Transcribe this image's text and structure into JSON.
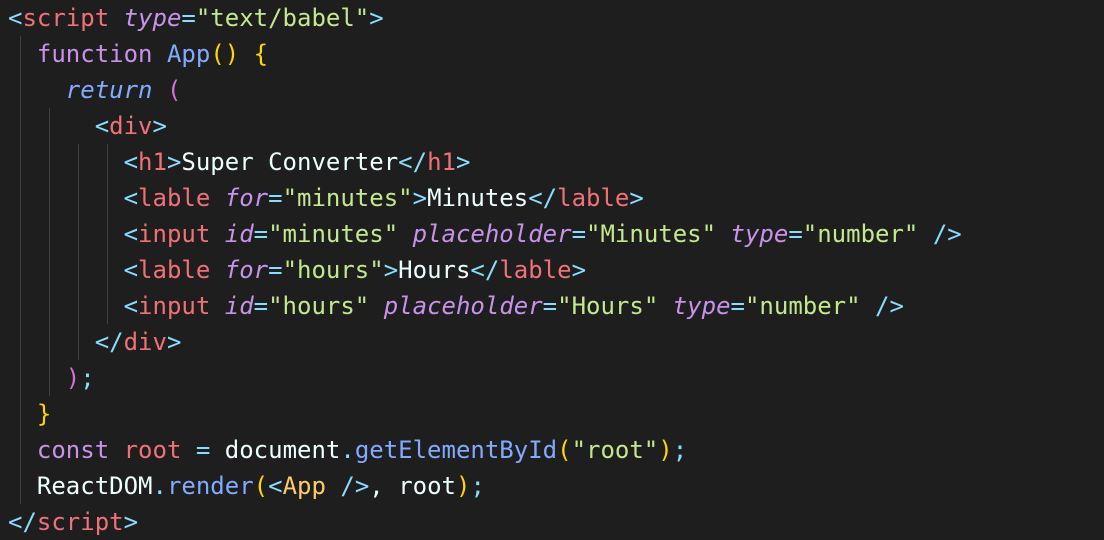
{
  "editor": {
    "language": "jsx",
    "lines": [
      [
        {
          "t": "<",
          "c": "t-punc"
        },
        {
          "t": "script",
          "c": "t-tag"
        },
        {
          "t": " ",
          "c": "t-plain"
        },
        {
          "t": "type",
          "c": "t-attr"
        },
        {
          "t": "=",
          "c": "t-punc"
        },
        {
          "t": "\"text/babel\"",
          "c": "t-str"
        },
        {
          "t": ">",
          "c": "t-punc"
        }
      ],
      [
        {
          "t": "  ",
          "c": "t-plain"
        },
        {
          "t": "function",
          "c": "t-kw"
        },
        {
          "t": " ",
          "c": "t-plain"
        },
        {
          "t": "App",
          "c": "t-fn"
        },
        {
          "t": "()",
          "c": "t-paren1"
        },
        {
          "t": " ",
          "c": "t-plain"
        },
        {
          "t": "{",
          "c": "t-paren1"
        }
      ],
      [
        {
          "t": "    ",
          "c": "t-plain"
        },
        {
          "t": "return",
          "c": "t-kw-it"
        },
        {
          "t": " ",
          "c": "t-plain"
        },
        {
          "t": "(",
          "c": "t-paren2"
        }
      ],
      [
        {
          "t": "      ",
          "c": "t-plain"
        },
        {
          "t": "<",
          "c": "t-punc"
        },
        {
          "t": "div",
          "c": "t-tag"
        },
        {
          "t": ">",
          "c": "t-punc"
        }
      ],
      [
        {
          "t": "        ",
          "c": "t-plain"
        },
        {
          "t": "<",
          "c": "t-punc"
        },
        {
          "t": "h1",
          "c": "t-tag"
        },
        {
          "t": ">",
          "c": "t-punc"
        },
        {
          "t": "Super Converter",
          "c": "t-plain"
        },
        {
          "t": "</",
          "c": "t-punc"
        },
        {
          "t": "h1",
          "c": "t-tag"
        },
        {
          "t": ">",
          "c": "t-punc"
        }
      ],
      [
        {
          "t": "        ",
          "c": "t-plain"
        },
        {
          "t": "<",
          "c": "t-punc"
        },
        {
          "t": "lable",
          "c": "t-tag"
        },
        {
          "t": " ",
          "c": "t-plain"
        },
        {
          "t": "for",
          "c": "t-attr"
        },
        {
          "t": "=",
          "c": "t-punc"
        },
        {
          "t": "\"minutes\"",
          "c": "t-str"
        },
        {
          "t": ">",
          "c": "t-punc"
        },
        {
          "t": "Minutes",
          "c": "t-plain"
        },
        {
          "t": "</",
          "c": "t-punc"
        },
        {
          "t": "lable",
          "c": "t-tag"
        },
        {
          "t": ">",
          "c": "t-punc"
        }
      ],
      [
        {
          "t": "        ",
          "c": "t-plain"
        },
        {
          "t": "<",
          "c": "t-punc"
        },
        {
          "t": "input",
          "c": "t-tag"
        },
        {
          "t": " ",
          "c": "t-plain"
        },
        {
          "t": "id",
          "c": "t-attr"
        },
        {
          "t": "=",
          "c": "t-punc"
        },
        {
          "t": "\"minutes\"",
          "c": "t-str"
        },
        {
          "t": " ",
          "c": "t-plain"
        },
        {
          "t": "placeholder",
          "c": "t-attr"
        },
        {
          "t": "=",
          "c": "t-punc"
        },
        {
          "t": "\"Minutes\"",
          "c": "t-str"
        },
        {
          "t": " ",
          "c": "t-plain"
        },
        {
          "t": "type",
          "c": "t-attr"
        },
        {
          "t": "=",
          "c": "t-punc"
        },
        {
          "t": "\"number\"",
          "c": "t-str"
        },
        {
          "t": " ",
          "c": "t-plain"
        },
        {
          "t": "/>",
          "c": "t-punc"
        }
      ],
      [
        {
          "t": "        ",
          "c": "t-plain"
        },
        {
          "t": "<",
          "c": "t-punc"
        },
        {
          "t": "lable",
          "c": "t-tag"
        },
        {
          "t": " ",
          "c": "t-plain"
        },
        {
          "t": "for",
          "c": "t-attr"
        },
        {
          "t": "=",
          "c": "t-punc"
        },
        {
          "t": "\"hours\"",
          "c": "t-str"
        },
        {
          "t": ">",
          "c": "t-punc"
        },
        {
          "t": "Hours",
          "c": "t-plain"
        },
        {
          "t": "</",
          "c": "t-punc"
        },
        {
          "t": "lable",
          "c": "t-tag"
        },
        {
          "t": ">",
          "c": "t-punc"
        }
      ],
      [
        {
          "t": "        ",
          "c": "t-plain"
        },
        {
          "t": "<",
          "c": "t-punc"
        },
        {
          "t": "input",
          "c": "t-tag"
        },
        {
          "t": " ",
          "c": "t-plain"
        },
        {
          "t": "id",
          "c": "t-attr"
        },
        {
          "t": "=",
          "c": "t-punc"
        },
        {
          "t": "\"hours\"",
          "c": "t-str"
        },
        {
          "t": " ",
          "c": "t-plain"
        },
        {
          "t": "placeholder",
          "c": "t-attr"
        },
        {
          "t": "=",
          "c": "t-punc"
        },
        {
          "t": "\"Hours\"",
          "c": "t-str"
        },
        {
          "t": " ",
          "c": "t-plain"
        },
        {
          "t": "type",
          "c": "t-attr"
        },
        {
          "t": "=",
          "c": "t-punc"
        },
        {
          "t": "\"number\"",
          "c": "t-str"
        },
        {
          "t": " ",
          "c": "t-plain"
        },
        {
          "t": "/>",
          "c": "t-punc"
        }
      ],
      [
        {
          "t": "      ",
          "c": "t-plain"
        },
        {
          "t": "</",
          "c": "t-punc"
        },
        {
          "t": "div",
          "c": "t-tag"
        },
        {
          "t": ">",
          "c": "t-punc"
        }
      ],
      [
        {
          "t": "    ",
          "c": "t-plain"
        },
        {
          "t": ")",
          "c": "t-paren2"
        },
        {
          "t": ";",
          "c": "t-punc"
        }
      ],
      [
        {
          "t": "  ",
          "c": "t-plain"
        },
        {
          "t": "}",
          "c": "t-paren1"
        }
      ],
      [
        {
          "t": "  ",
          "c": "t-plain"
        },
        {
          "t": "const",
          "c": "t-kw"
        },
        {
          "t": " ",
          "c": "t-plain"
        },
        {
          "t": "root",
          "c": "t-tag"
        },
        {
          "t": " ",
          "c": "t-plain"
        },
        {
          "t": "=",
          "c": "t-punc"
        },
        {
          "t": " ",
          "c": "t-plain"
        },
        {
          "t": "document",
          "c": "t-plain"
        },
        {
          "t": ".",
          "c": "t-punc"
        },
        {
          "t": "getElementById",
          "c": "t-fn"
        },
        {
          "t": "(",
          "c": "t-paren1"
        },
        {
          "t": "\"root\"",
          "c": "t-str"
        },
        {
          "t": ")",
          "c": "t-paren1"
        },
        {
          "t": ";",
          "c": "t-punc"
        }
      ],
      [
        {
          "t": "  ",
          "c": "t-plain"
        },
        {
          "t": "ReactDOM",
          "c": "t-plain"
        },
        {
          "t": ".",
          "c": "t-punc"
        },
        {
          "t": "render",
          "c": "t-fn"
        },
        {
          "t": "(",
          "c": "t-paren1"
        },
        {
          "t": "<",
          "c": "t-punc"
        },
        {
          "t": "App",
          "c": "t-comp"
        },
        {
          "t": " ",
          "c": "t-plain"
        },
        {
          "t": "/>",
          "c": "t-punc"
        },
        {
          "t": ", ",
          "c": "t-plain"
        },
        {
          "t": "root",
          "c": "t-plain"
        },
        {
          "t": ")",
          "c": "t-paren1"
        },
        {
          "t": ";",
          "c": "t-punc"
        }
      ],
      [
        {
          "t": "</",
          "c": "t-punc"
        },
        {
          "t": "script",
          "c": "t-tag"
        },
        {
          "t": ">",
          "c": "t-punc"
        }
      ]
    ]
  }
}
